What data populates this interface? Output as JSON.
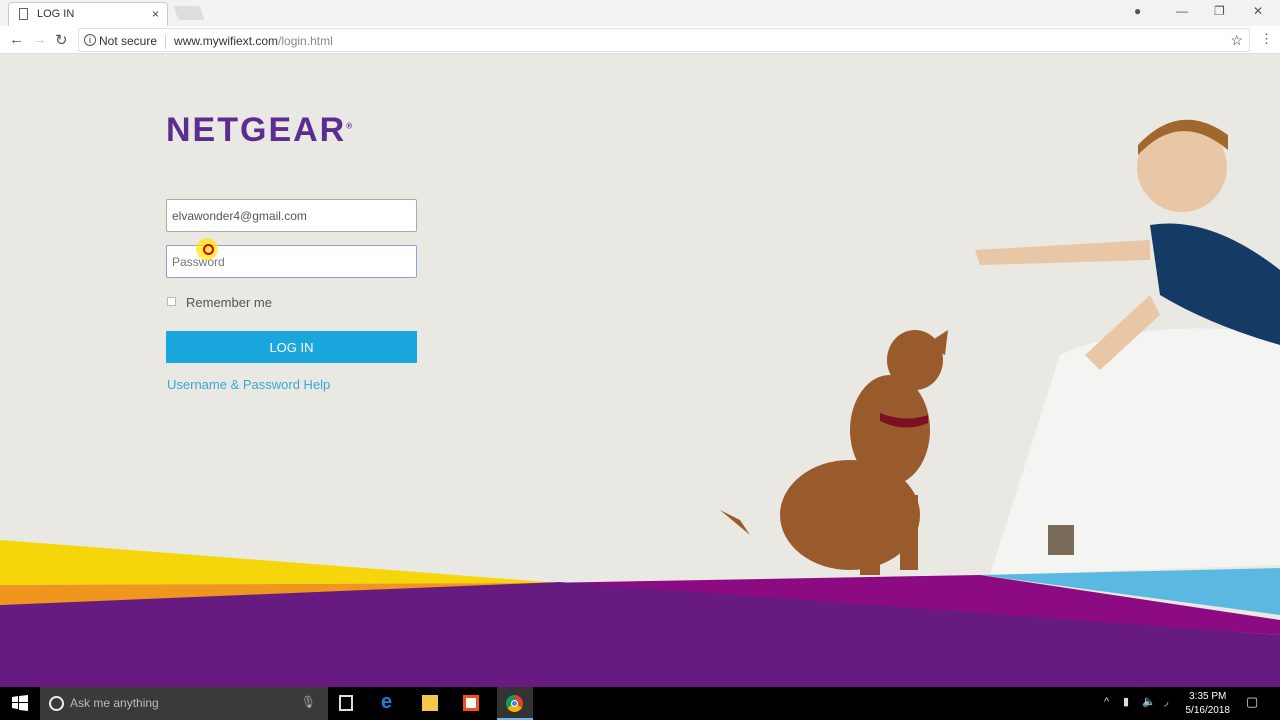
{
  "browser": {
    "tab_title": "LOG IN",
    "close": "×",
    "url_host": "www.mywifiext.com",
    "url_path": "/login.html",
    "security": "Not secure"
  },
  "page": {
    "logo": "NETGEAR",
    "email_value": "elvawonder4@gmail.com",
    "password_placeholder": "Password",
    "remember_label": "Remember me",
    "remember_checked": false,
    "login_label": "LOG IN",
    "help_link": "Username & Password Help",
    "colors": {
      "brand_purple": "#5c2d91",
      "button": "#1aa7dd",
      "link": "#3aa8d8",
      "band_yellow": "#f5d60a",
      "band_orange": "#f0961e",
      "band_purple": "#671a80",
      "band_magenta": "#8c0a82",
      "band_blue": "#5bb8e0"
    }
  },
  "taskbar": {
    "search_placeholder": "Ask me anything",
    "time": "3:35 PM",
    "date": "5/16/2018"
  }
}
